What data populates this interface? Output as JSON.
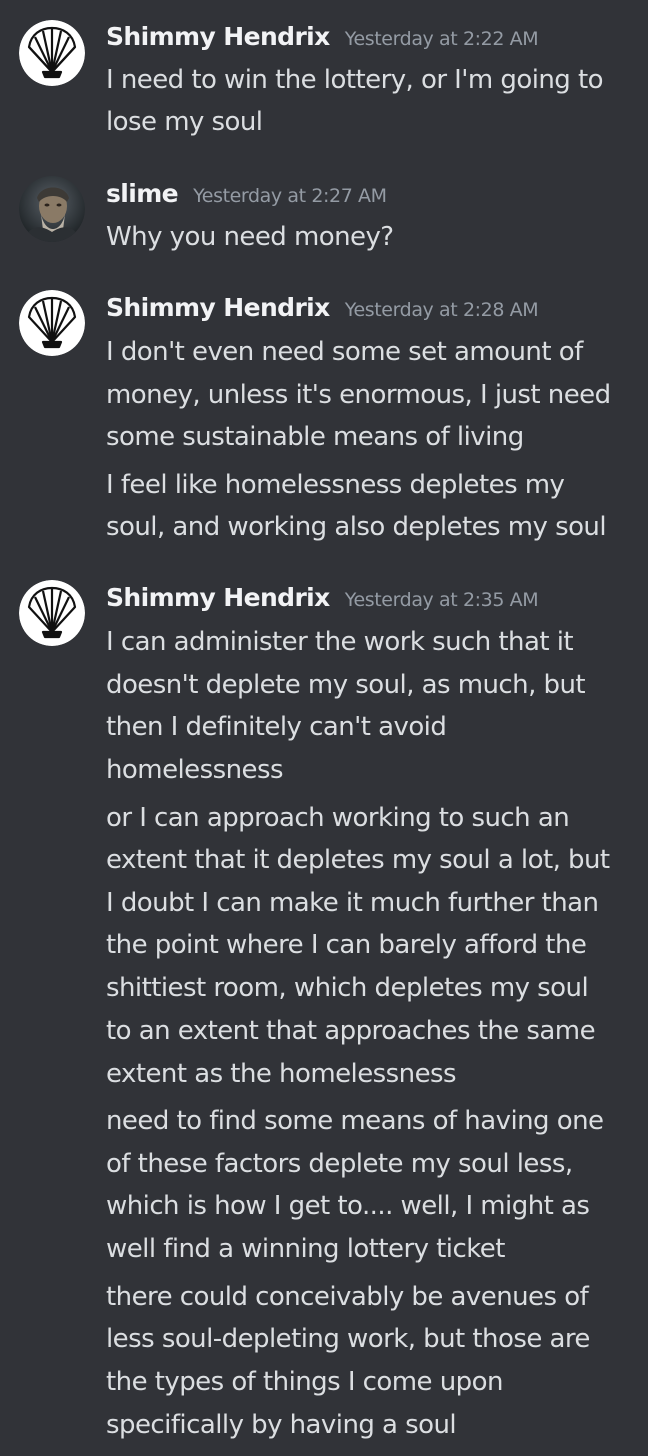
{
  "messages": [
    {
      "author": "Shimmy Hendrix",
      "timestamp": "Yesterday at 2:22 AM",
      "avatar": "shell-icon",
      "paragraphs": [
        [
          "I need to win the lottery, or I'm going to",
          "lose my soul"
        ]
      ]
    },
    {
      "author": "slime",
      "timestamp": "Yesterday at 2:27 AM",
      "avatar": "user-photo-avatar",
      "paragraphs": [
        [
          "Why you need money?"
        ]
      ]
    },
    {
      "author": "Shimmy Hendrix",
      "timestamp": "Yesterday at 2:28 AM",
      "avatar": "shell-icon",
      "paragraphs": [
        [
          "I don't even need some set amount of",
          "money, unless it's enormous, I just need",
          "some sustainable means of living"
        ],
        [
          "I feel like homelessness depletes my",
          "soul, and working also depletes my soul"
        ]
      ]
    },
    {
      "author": "Shimmy Hendrix",
      "timestamp": "Yesterday at 2:35 AM",
      "avatar": "shell-icon",
      "paragraphs": [
        [
          "I can administer the work such that it",
          "doesn't deplete my soul, as much, but",
          "then I definitely can't avoid",
          "homelessness"
        ],
        [
          "or I can approach working to such an",
          "extent that it depletes my soul a lot, but",
          "I doubt I can make it much further than",
          "the point where I can barely afford the",
          "shittiest room, which depletes my soul",
          "to an extent that approaches the same",
          "extent as the homelessness"
        ],
        [
          "need to find some means of having one",
          "of these factors deplete my soul less,",
          "which is how I get to.... well, I might as",
          "well find a winning lottery ticket"
        ],
        [
          "there could conceivably be avenues of",
          "less soul-depleting work, but those are",
          "the types of things I come upon",
          "specifically by having a soul"
        ]
      ]
    }
  ],
  "colors": {
    "background": "#313338",
    "username": "#f2f3f5",
    "timestamp": "#949ba4",
    "text": "#dbdee1"
  }
}
